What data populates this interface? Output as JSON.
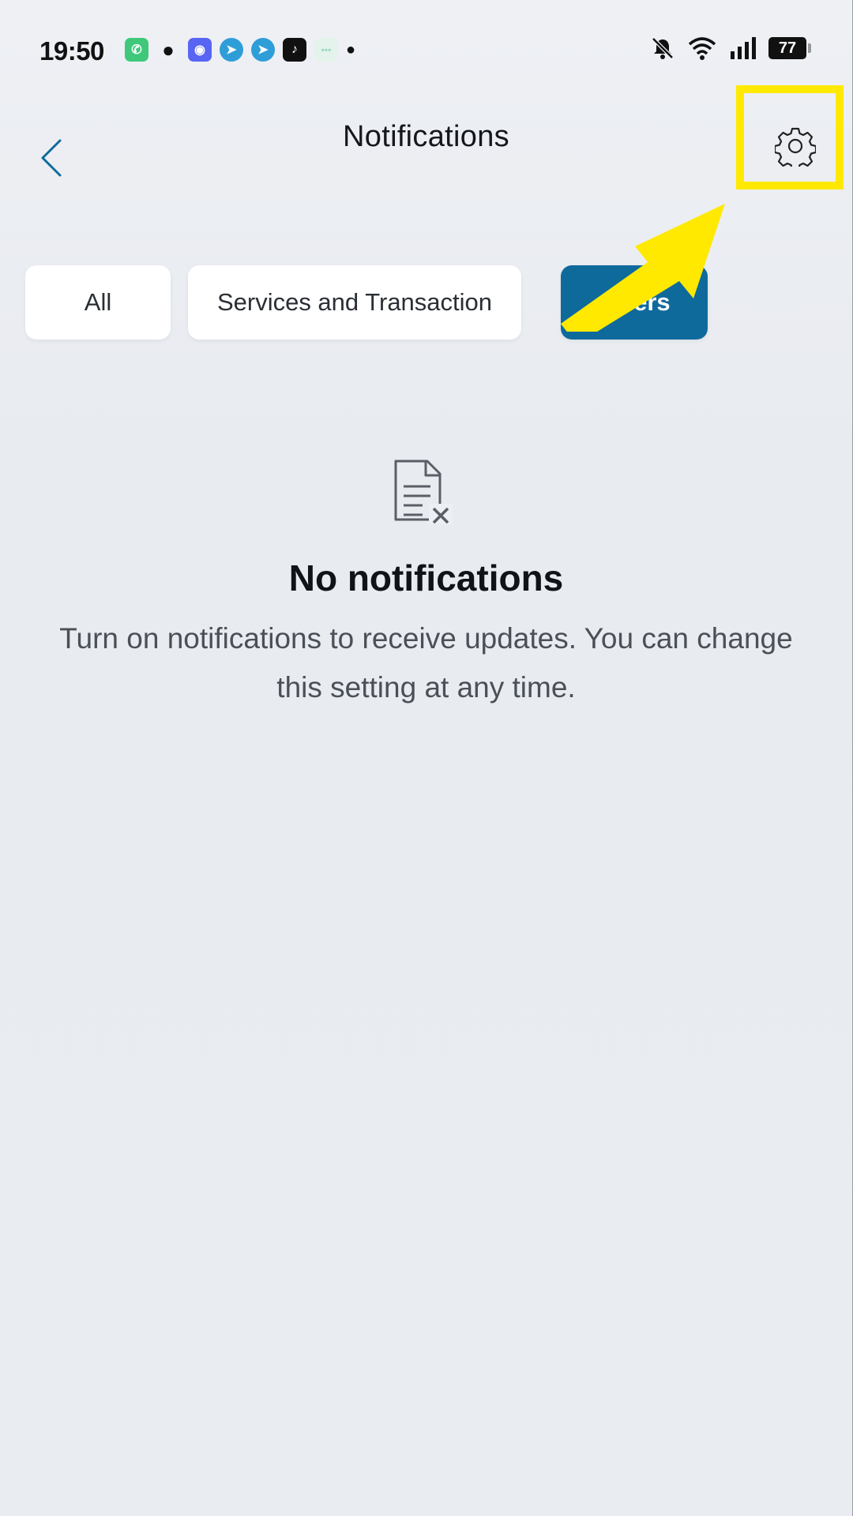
{
  "status_bar": {
    "time": "19:50",
    "battery": "77"
  },
  "header": {
    "title": "Notifications"
  },
  "tabs": [
    {
      "label": "All",
      "active": false
    },
    {
      "label": "Services and Transaction",
      "active": false
    },
    {
      "label": "Offers",
      "active": true
    }
  ],
  "empty_state": {
    "icon": "document-x-icon",
    "title": "No notifications",
    "message": "Turn on notifications to receive updates. You can change this setting at any time."
  },
  "colors": {
    "accent": "#0f6a9c",
    "highlight": "#ffe900",
    "background": "#e8ebf0"
  }
}
